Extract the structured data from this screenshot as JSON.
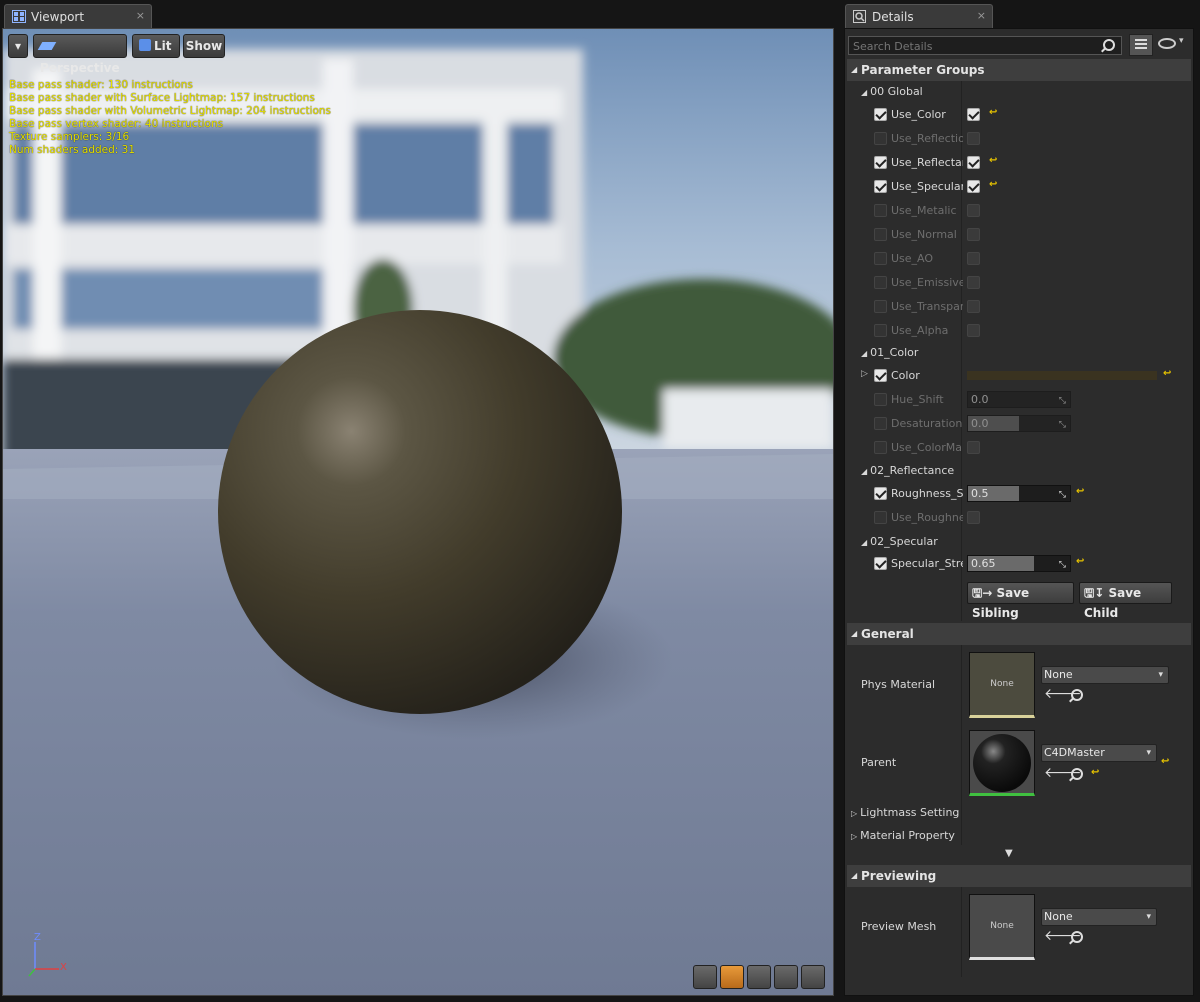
{
  "viewport_tab": {
    "title": "Viewport",
    "close": "×"
  },
  "details_tab": {
    "title": "Details",
    "close": "×"
  },
  "toolbar": {
    "perspective": "Perspective",
    "lit": "Lit",
    "show": "Show",
    "dropdown": "▾"
  },
  "stats": [
    "Base pass shader: 130 instructions",
    "Base pass shader with Surface Lightmap: 157 instructions",
    "Base pass shader with Volumetric Lightmap: 204 instructions",
    "Base pass vertex shader: 40 instructions",
    "Texture samplers: 3/16",
    "Num shaders added: 31"
  ],
  "axis": {
    "z": "Z",
    "x": "X",
    "y": "Y"
  },
  "search": {
    "placeholder": "Search Details"
  },
  "parameter_groups": {
    "title": "Parameter Groups",
    "groups": [
      {
        "name": "00 Global"
      },
      {
        "name": "01_Color"
      },
      {
        "name": "02_Reflectance"
      },
      {
        "name": "02_Specular"
      }
    ],
    "global": [
      {
        "label": "Use_Color",
        "enabled": true,
        "value": true
      },
      {
        "label": "Use_Reflection",
        "enabled": false,
        "value": false
      },
      {
        "label": "Use_Reflectance",
        "enabled": true,
        "value": true
      },
      {
        "label": "Use_Specular",
        "enabled": true,
        "value": true
      },
      {
        "label": "Use_Metalic",
        "enabled": false,
        "value": false
      },
      {
        "label": "Use_Normal",
        "enabled": false,
        "value": false
      },
      {
        "label": "Use_AO",
        "enabled": false,
        "value": false
      },
      {
        "label": "Use_Emissive",
        "enabled": false,
        "value": false
      },
      {
        "label": "Use_Transparency",
        "enabled": false,
        "value": false
      },
      {
        "label": "Use_Alpha",
        "enabled": false,
        "value": false
      }
    ],
    "color": {
      "label": "Color",
      "swatch": "#3a3320"
    },
    "hue_shift": {
      "label": "Hue_Shift",
      "value": "0.0",
      "fill": 0
    },
    "desaturation": {
      "label": "Desaturation",
      "value": "0.0",
      "fill": 0.5
    },
    "use_colormap": {
      "label": "Use_ColorMap"
    },
    "roughness": {
      "label": "Roughness_Strength",
      "value": "0.5",
      "fill": 0.5
    },
    "use_roughness": {
      "label": "Use_RoughnessMap"
    },
    "specular": {
      "label": "Specular_Strength",
      "value": "0.65",
      "fill": 0.65
    },
    "save_sibling": "Save Sibling",
    "save_child": "Save Child"
  },
  "general": {
    "title": "General",
    "phys_material": {
      "label": "Phys Material",
      "thumb": "None",
      "value": "None"
    },
    "parent": {
      "label": "Parent",
      "value": "C4DMaster"
    },
    "lightmass": "Lightmass Settings",
    "material_property": "Material Property Overrides"
  },
  "previewing": {
    "title": "Previewing",
    "preview_mesh": {
      "label": "Preview Mesh",
      "thumb": "None",
      "value": "None"
    }
  },
  "colors": {
    "accent": "#e6c200",
    "stats_text": "#e6e000",
    "panel": "#2c2c2c",
    "section": "#3e3e3e"
  }
}
